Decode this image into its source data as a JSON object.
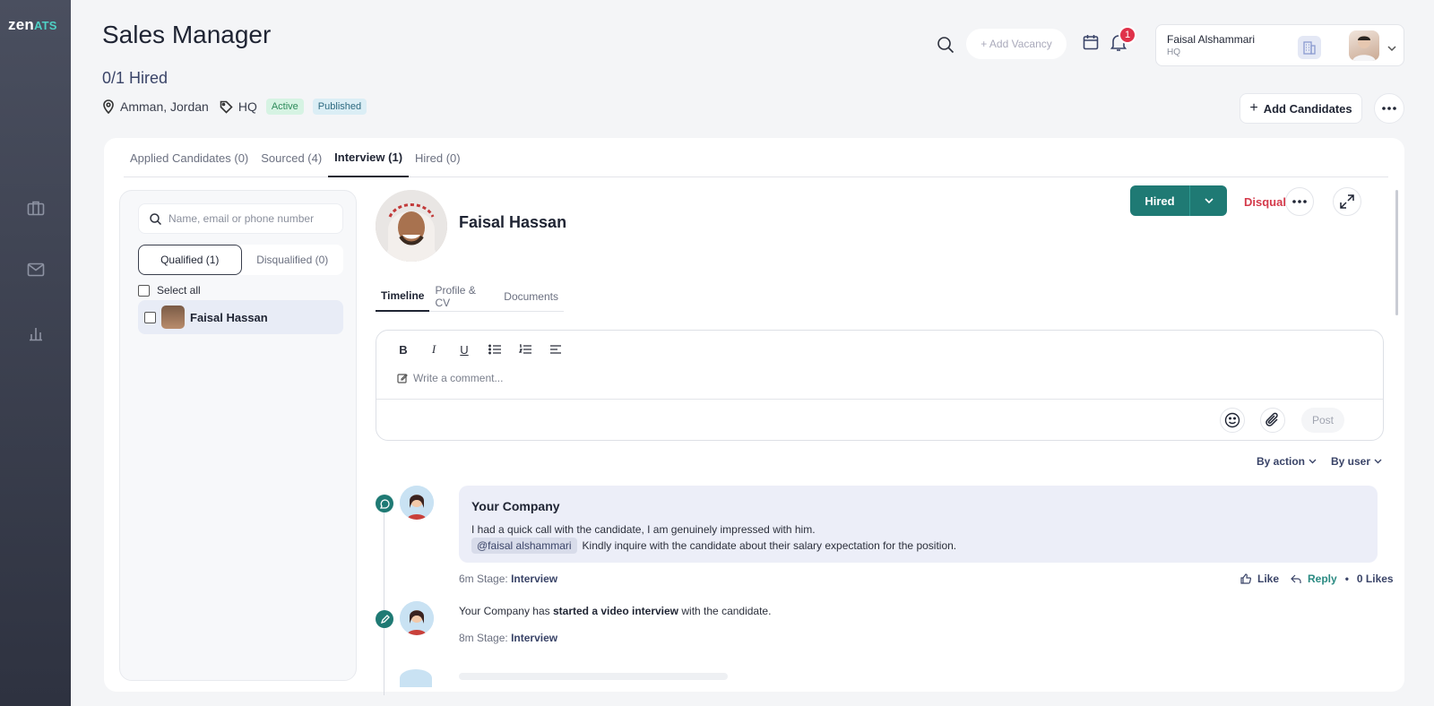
{
  "brand": {
    "name_main": "zen",
    "name_accent": "ATS"
  },
  "sidebar": {
    "icons": [
      "briefcase-icon",
      "mail-icon",
      "bar-chart-icon"
    ]
  },
  "job": {
    "title": "Sales Manager",
    "hired": "0/1 Hired",
    "location": "Amman, Jordan",
    "tag": "HQ",
    "status_active": "Active",
    "status_published": "Published"
  },
  "header": {
    "add_vacancy": "+ Add Vacancy",
    "notification_count": "1",
    "user_name": "Faisal Alshammari",
    "user_org": "HQ",
    "add_candidates": "Add Candidates"
  },
  "stage_tabs": [
    {
      "label": "Applied Candidates (0)"
    },
    {
      "label": "Sourced (4)"
    },
    {
      "label": "Interview (1)"
    },
    {
      "label": "Hired (0)"
    }
  ],
  "candidates_panel": {
    "search_placeholder": "Name, email or phone number",
    "qualified": "Qualified (1)",
    "disqualified": "Disqualified (0)",
    "select_all": "Select all",
    "items": [
      {
        "name": "Faisal Hassan"
      }
    ]
  },
  "candidate": {
    "name": "Faisal Hassan",
    "hired_label": "Hired",
    "disqualify_label": "Disqualify"
  },
  "detail_tabs": [
    {
      "label": "Timeline"
    },
    {
      "label": "Profile & CV"
    },
    {
      "label": "Documents"
    }
  ],
  "editor": {
    "placeholder": "Write a comment...",
    "post": "Post"
  },
  "filters": {
    "by_action": "By action",
    "by_user": "By user"
  },
  "timeline": {
    "comment": {
      "author": "Your Company",
      "line1": "I had a quick call with the candidate, I am genuinely impressed with him.",
      "mention": "@faisal alshammari",
      "line2": "Kindly inquire with the candidate about their salary expectation for the position.",
      "time": "6m",
      "stage_prefix": "Stage:",
      "stage": "Interview",
      "like": "Like",
      "reply": "Reply",
      "likes": "0 Likes"
    },
    "event": {
      "actor": "Your Company has",
      "action": "started a video interview",
      "suffix": "with the candidate.",
      "time": "8m",
      "stage_prefix": "Stage:",
      "stage": "Interview"
    }
  },
  "colors": {
    "primary": "#1f7a74",
    "danger": "#d43a4b",
    "sidebar": "#3a3e4c"
  }
}
